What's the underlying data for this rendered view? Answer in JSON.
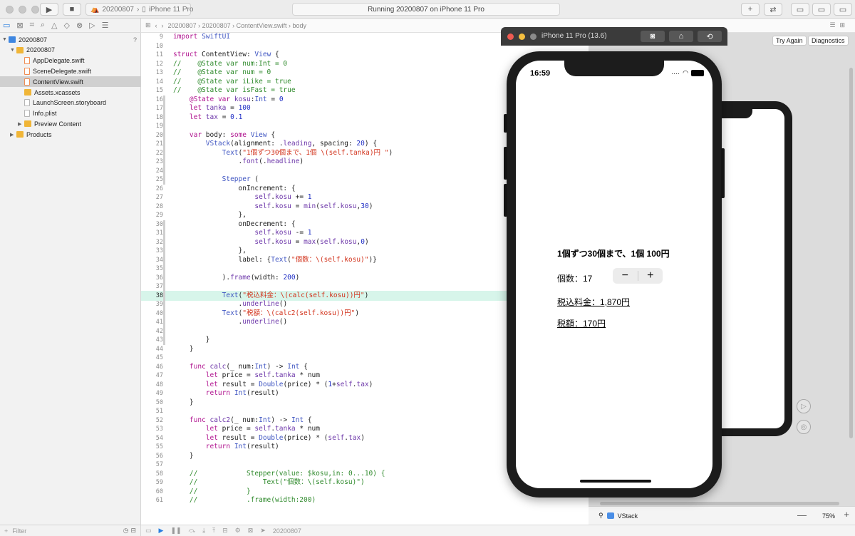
{
  "toolbar": {
    "scheme_project": "20200807",
    "scheme_device": "iPhone 11 Pro",
    "activity": "Running 20200807 on iPhone 11 Pro",
    "play_icon": "play-icon",
    "stop_icon": "stop-icon",
    "add_label": "+"
  },
  "navigator": {
    "items": [
      {
        "label": "20200807",
        "kind": "project",
        "indent": 0
      },
      {
        "label": "20200807",
        "kind": "folder",
        "indent": 1
      },
      {
        "label": "AppDelegate.swift",
        "kind": "swift",
        "indent": 2
      },
      {
        "label": "SceneDelegate.swift",
        "kind": "swift",
        "indent": 2
      },
      {
        "label": "ContentView.swift",
        "kind": "swift",
        "indent": 2,
        "selected": true
      },
      {
        "label": "Assets.xcassets",
        "kind": "folder",
        "indent": 2
      },
      {
        "label": "LaunchScreen.storyboard",
        "kind": "file",
        "indent": 2
      },
      {
        "label": "Info.plist",
        "kind": "file",
        "indent": 2
      },
      {
        "label": "Preview Content",
        "kind": "folder",
        "indent": 2
      },
      {
        "label": "Products",
        "kind": "folder",
        "indent": 1
      }
    ],
    "question_mark": "?",
    "filter_placeholder": "Filter"
  },
  "jumpbar": {
    "crumbs": [
      "20200807",
      "20200807",
      "ContentView.swift",
      "body"
    ]
  },
  "editor": {
    "first_line": 9,
    "highlight_line": 38,
    "lines": [
      "import SwiftUI",
      "",
      "struct ContentView: View {",
      "//    @State var num:Int = 0",
      "//    @State var num = 0",
      "//    @State var iLike = true",
      "//    @State var isFast = true",
      "    @State var kosu:Int = 0",
      "    let tanka = 100",
      "    let tax = 0.1",
      "",
      "    var body: some View {",
      "        VStack(alignment: .leading, spacing: 20) {",
      "            Text(\"1個ずつ30個まで、1個 \\(self.tanka)円 \")",
      "                .font(.headline)",
      "",
      "            Stepper (",
      "                onIncrement: {",
      "                    self.kosu += 1",
      "                    self.kosu = min(self.kosu,30)",
      "                },",
      "                onDecrement: {",
      "                    self.kosu -= 1",
      "                    self.kosu = max(self.kosu,0)",
      "                },",
      "                label: {Text(\"個数：\\(self.kosu)\")}",
      "",
      "            ).frame(width: 200)",
      "",
      "            Text(\"税込料金：\\(calc(self.kosu))円\")",
      "                .underline()",
      "            Text(\"税額：\\(calc2(self.kosu))円\")",
      "                .underline()",
      "",
      "        }",
      "    }",
      "",
      "    func calc(_ num:Int) -> Int {",
      "        let price = self.tanka * num",
      "        let result = Double(price) * (1+self.tax)",
      "        return Int(result)",
      "    }",
      "",
      "    func calc2(_ num:Int) -> Int {",
      "        let price = self.tanka * num",
      "        let result = Double(price) * (self.tax)",
      "        return Int(result)",
      "    }",
      "",
      "    //            Stepper(value: $kosu,in: 0...10) {",
      "    //                Text(\"個数：\\(self.kosu)\")",
      "    //            }",
      "    //            .frame(width:200)"
    ],
    "footer_label": "20200807"
  },
  "preview": {
    "try_again": "Try Again",
    "diagnostics": "Diagnostics",
    "breadcrumb": "VStack",
    "zoom": "75%",
    "zoom_minus": "—",
    "zoom_plus": "+"
  },
  "simulator": {
    "title": "iPhone 11 Pro (13.6)",
    "buttons": [
      "screenshot-icon",
      "home-icon",
      "rotate-icon"
    ],
    "status_time": "16:59",
    "app": {
      "headline": "1個ずつ30個まで、1個 100円",
      "count_label": "個数：17",
      "stepper_minus": "−",
      "stepper_plus": "+",
      "price_label": "税込料金：1,870円",
      "tax_label": "税額：170円"
    }
  },
  "colors": {
    "accent": "#2a7fe0",
    "highlight_line": "#d7f5ea",
    "keyword": "#b0138f",
    "string": "#d2321b",
    "comment": "#2f8a2c"
  }
}
